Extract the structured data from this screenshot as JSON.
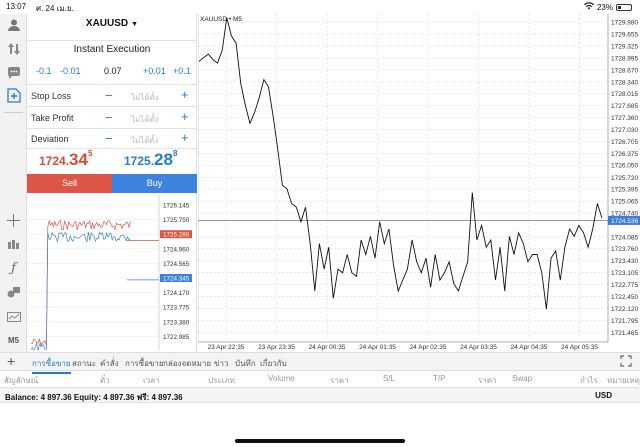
{
  "status": {
    "time": "13:07",
    "date": "ศ. 24 เม.ย.",
    "battery": "23%",
    "battery_level": 0.23
  },
  "panel": {
    "symbol": "XAUUSD",
    "execution": "Instant Execution",
    "volume": {
      "m1": "-0.1",
      "m2": "-0.01",
      "value": "0.07",
      "p1": "+0.01",
      "p2": "+0.1"
    },
    "stop_loss": {
      "label": "Stop Loss",
      "value": "ไม่ได้ตั้ง"
    },
    "take_profit": {
      "label": "Take Profit",
      "value": "ไม่ได้ตั้ง"
    },
    "deviation": {
      "label": "Deviation",
      "value": "ไม่ได้ตั้ง"
    },
    "sell_price": {
      "big": "1724.",
      "emph": "34",
      "small": "5"
    },
    "buy_price": {
      "big": "1725.",
      "emph": "28",
      "small": "8"
    },
    "sell_label": "Sell",
    "buy_label": "Buy",
    "colors": {
      "sell": "#dd5544",
      "buy": "#3b83de"
    }
  },
  "tick_chart": {
    "levels": [
      "1726.145",
      "1725.750",
      "1725.288",
      "1724.960",
      "1724.565",
      "1724.345",
      "1724.170",
      "1723.775",
      "1723.380",
      "1722.985"
    ],
    "bid_tag": "1725.288",
    "ask_tag": "1724.345"
  },
  "chart_data": {
    "type": "line",
    "title": "XAUUSD • M5",
    "xlabel": "",
    "ylabel": "",
    "ylim": [
      1721.2,
      1730.2
    ],
    "y_ticks": [
      "1729.980",
      "1729.655",
      "1729.325",
      "1728.995",
      "1728.670",
      "1728.340",
      "1728.015",
      "1727.685",
      "1727.360",
      "1727.030",
      "1726.705",
      "1726.375",
      "1726.050",
      "1725.720",
      "1725.395",
      "1725.065",
      "1724.740",
      "1724.085",
      "1723.760",
      "1723.430",
      "1723.105",
      "1722.775",
      "1722.450",
      "1722.120",
      "1721.795",
      "1721.465"
    ],
    "current_price_label": "1724.536",
    "current_price": 1724.536,
    "x_labels": [
      "23 Apr 22:35",
      "23 Apr 23:35",
      "24 Apr 00:35",
      "24 Apr 01:35",
      "24 Apr 02:35",
      "24 Apr 03:35",
      "24 Apr 04:35",
      "24 Apr 05:35"
    ],
    "values": [
      1728.9,
      1729.0,
      1729.1,
      1728.95,
      1728.85,
      1729.2,
      1730.1,
      1729.6,
      1729.4,
      1728.3,
      1727.7,
      1727.2,
      1727.5,
      1727.9,
      1728.4,
      1728.2,
      1727.4,
      1726.5,
      1725.5,
      1725.4,
      1725.0,
      1724.9,
      1724.5,
      1724.9,
      1723.9,
      1722.6,
      1723.9,
      1723.2,
      1723.8,
      1722.4,
      1723.2,
      1723.1,
      1723.6,
      1723.1,
      1723.0,
      1724.0,
      1723.6,
      1724.1,
      1723.5,
      1724.5,
      1723.9,
      1724.3,
      1723.3,
      1722.6,
      1722.9,
      1723.2,
      1724.0,
      1723.4,
      1723.1,
      1723.5,
      1722.7,
      1723.6,
      1722.9,
      1723.1,
      1723.4,
      1722.8,
      1722.6,
      1723.0,
      1723.4,
      1725.3,
      1724.0,
      1724.4,
      1723.8,
      1724.0,
      1722.9,
      1723.8,
      1722.6,
      1724.1,
      1723.6,
      1724.2,
      1723.9,
      1723.4,
      1723.6,
      1723.6,
      1723.1,
      1722.1,
      1723.5,
      1723.7,
      1722.9,
      1723.8,
      1724.3,
      1724.1,
      1724.4,
      1724.2,
      1723.8,
      1724.3,
      1725.0,
      1724.6
    ],
    "grid": true
  },
  "tabs": {
    "items": [
      "การซื้อขาย",
      "สถานะ",
      "คำสั่ง",
      "การซื้อขาย",
      "กล่องจดหมาย",
      "ข่าว",
      "บันทึก",
      "เกี่ยวกับ"
    ],
    "active": 0
  },
  "columns": [
    "สัญลักษณ์",
    "ตั๋ว",
    "เวลา",
    "ประเภท",
    "Volume",
    "ราคา",
    "S/L",
    "T/P",
    "ราคา",
    "Swap",
    "กำไร",
    "หมายเหตุ"
  ],
  "balance": {
    "text": "Balance: 4 897.36 Equity: 4 897.36 ฟรี: 4 897.36",
    "currency": "USD"
  }
}
